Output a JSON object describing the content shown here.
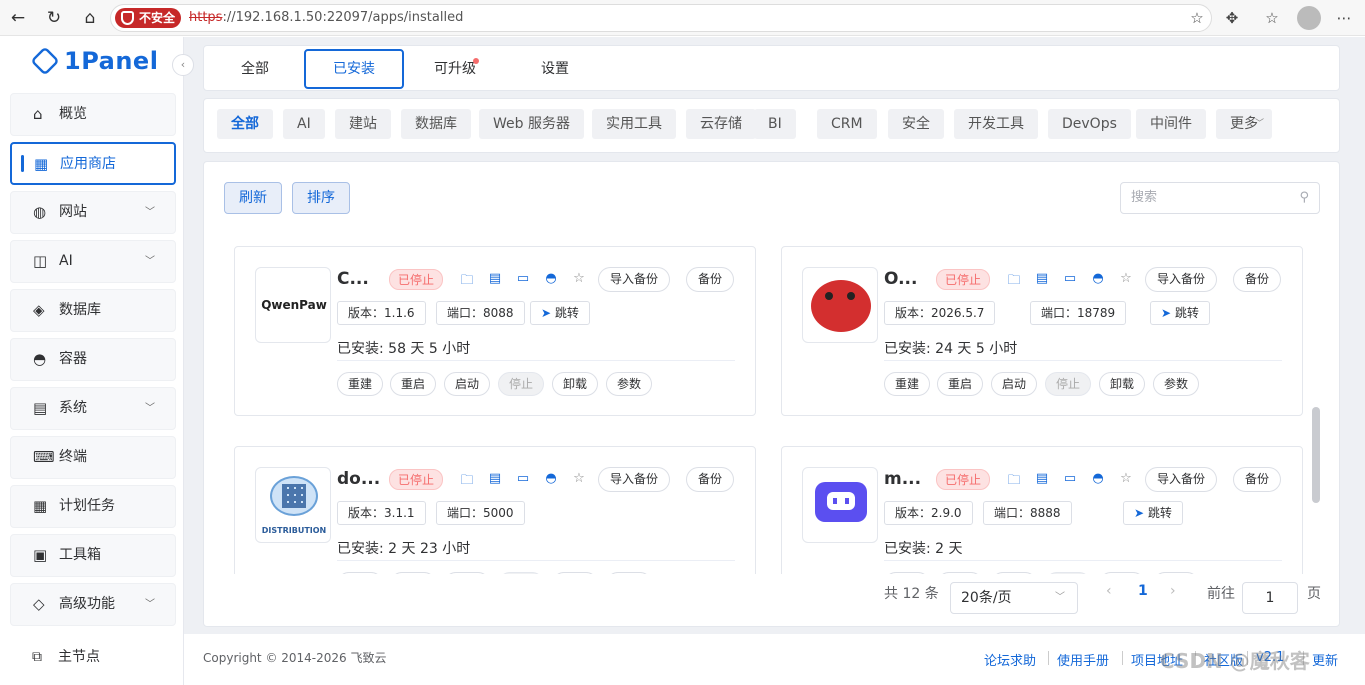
{
  "browser": {
    "insecure": "不安全",
    "url_proto": "https",
    "url_rest": "://192.168.1.50:22097/apps/installed"
  },
  "sidebar": {
    "logo": "1Panel",
    "items": [
      {
        "label": "概览",
        "icon": "home-icon",
        "glyph": "⌂",
        "arrow": ""
      },
      {
        "label": "应用商店",
        "icon": "grid-icon",
        "glyph": "▦",
        "arrow": ""
      },
      {
        "label": "网站",
        "icon": "globe-icon",
        "glyph": "◍",
        "arrow": "﹀"
      },
      {
        "label": "AI",
        "icon": "robot-icon",
        "glyph": "◫",
        "arrow": "﹀"
      },
      {
        "label": "数据库",
        "icon": "layers-icon",
        "glyph": "◈",
        "arrow": ""
      },
      {
        "label": "容器",
        "icon": "docker-icon",
        "glyph": "◓",
        "arrow": ""
      },
      {
        "label": "系统",
        "icon": "system-icon",
        "glyph": "▤",
        "arrow": "﹀"
      },
      {
        "label": "终端",
        "icon": "terminal-icon",
        "glyph": "⌨",
        "arrow": ""
      },
      {
        "label": "计划任务",
        "icon": "calendar-icon",
        "glyph": "▦",
        "arrow": ""
      },
      {
        "label": "工具箱",
        "icon": "toolbox-icon",
        "glyph": "▣",
        "arrow": ""
      },
      {
        "label": "高级功能",
        "icon": "diamond-icon",
        "glyph": "◇",
        "arrow": "﹀"
      }
    ],
    "node": {
      "label": "主节点",
      "glyph": "⧉"
    }
  },
  "tabs": [
    "全部",
    "已安装",
    "可升级",
    "设置"
  ],
  "categories": [
    "全部",
    "AI",
    "建站",
    "数据库",
    "Web 服务器",
    "实用工具",
    "云存储",
    "BI",
    "CRM",
    "安全",
    "开发工具",
    "DevOps",
    "中间件",
    "更多"
  ],
  "toolbar": {
    "refresh": "刷新",
    "sort": "排序",
    "search_placeholder": "搜索"
  },
  "apps": [
    {
      "name": "C...",
      "status": "已停止",
      "version": "版本：1.1.6",
      "port": "端口：8088",
      "jump": "跳转",
      "installed": "已安装:   58 天 5 小时",
      "logo_text": "QwenPaw"
    },
    {
      "name": "O...",
      "status": "已停止",
      "version": "版本：2026.5.7",
      "port": "端口：18789",
      "jump": "跳转",
      "installed": "已安装:   24 天 5 小时",
      "logo_text": ""
    },
    {
      "name": "do...",
      "status": "已停止",
      "version": "版本：3.1.1",
      "port": "端口：5000",
      "jump": "",
      "installed": "已安装:   2 天 23 小时",
      "logo_text": "DISTRIBUTION"
    },
    {
      "name": "m...",
      "status": "已停止",
      "version": "版本：2.9.0",
      "port": "端口：8888",
      "jump": "跳转",
      "installed": "已安装:   2 天",
      "logo_text": ""
    }
  ],
  "card_buttons": {
    "import_backup": "导入备份",
    "backup": "备份"
  },
  "actions": [
    "重建",
    "重启",
    "启动",
    "停止",
    "卸载",
    "参数"
  ],
  "pagination": {
    "total": "共 12 条",
    "page_size": "20条/页",
    "current": "1",
    "goto": "前往",
    "goto_value": "1",
    "page_unit": "页"
  },
  "footer": {
    "copyright": "Copyright © 2014-2026 飞致云",
    "links": [
      "论坛求助",
      "使用手册",
      "项目地址",
      "社区版",
      "v2.1",
      "更新"
    ]
  },
  "watermark": "CSDN @魔秋客"
}
